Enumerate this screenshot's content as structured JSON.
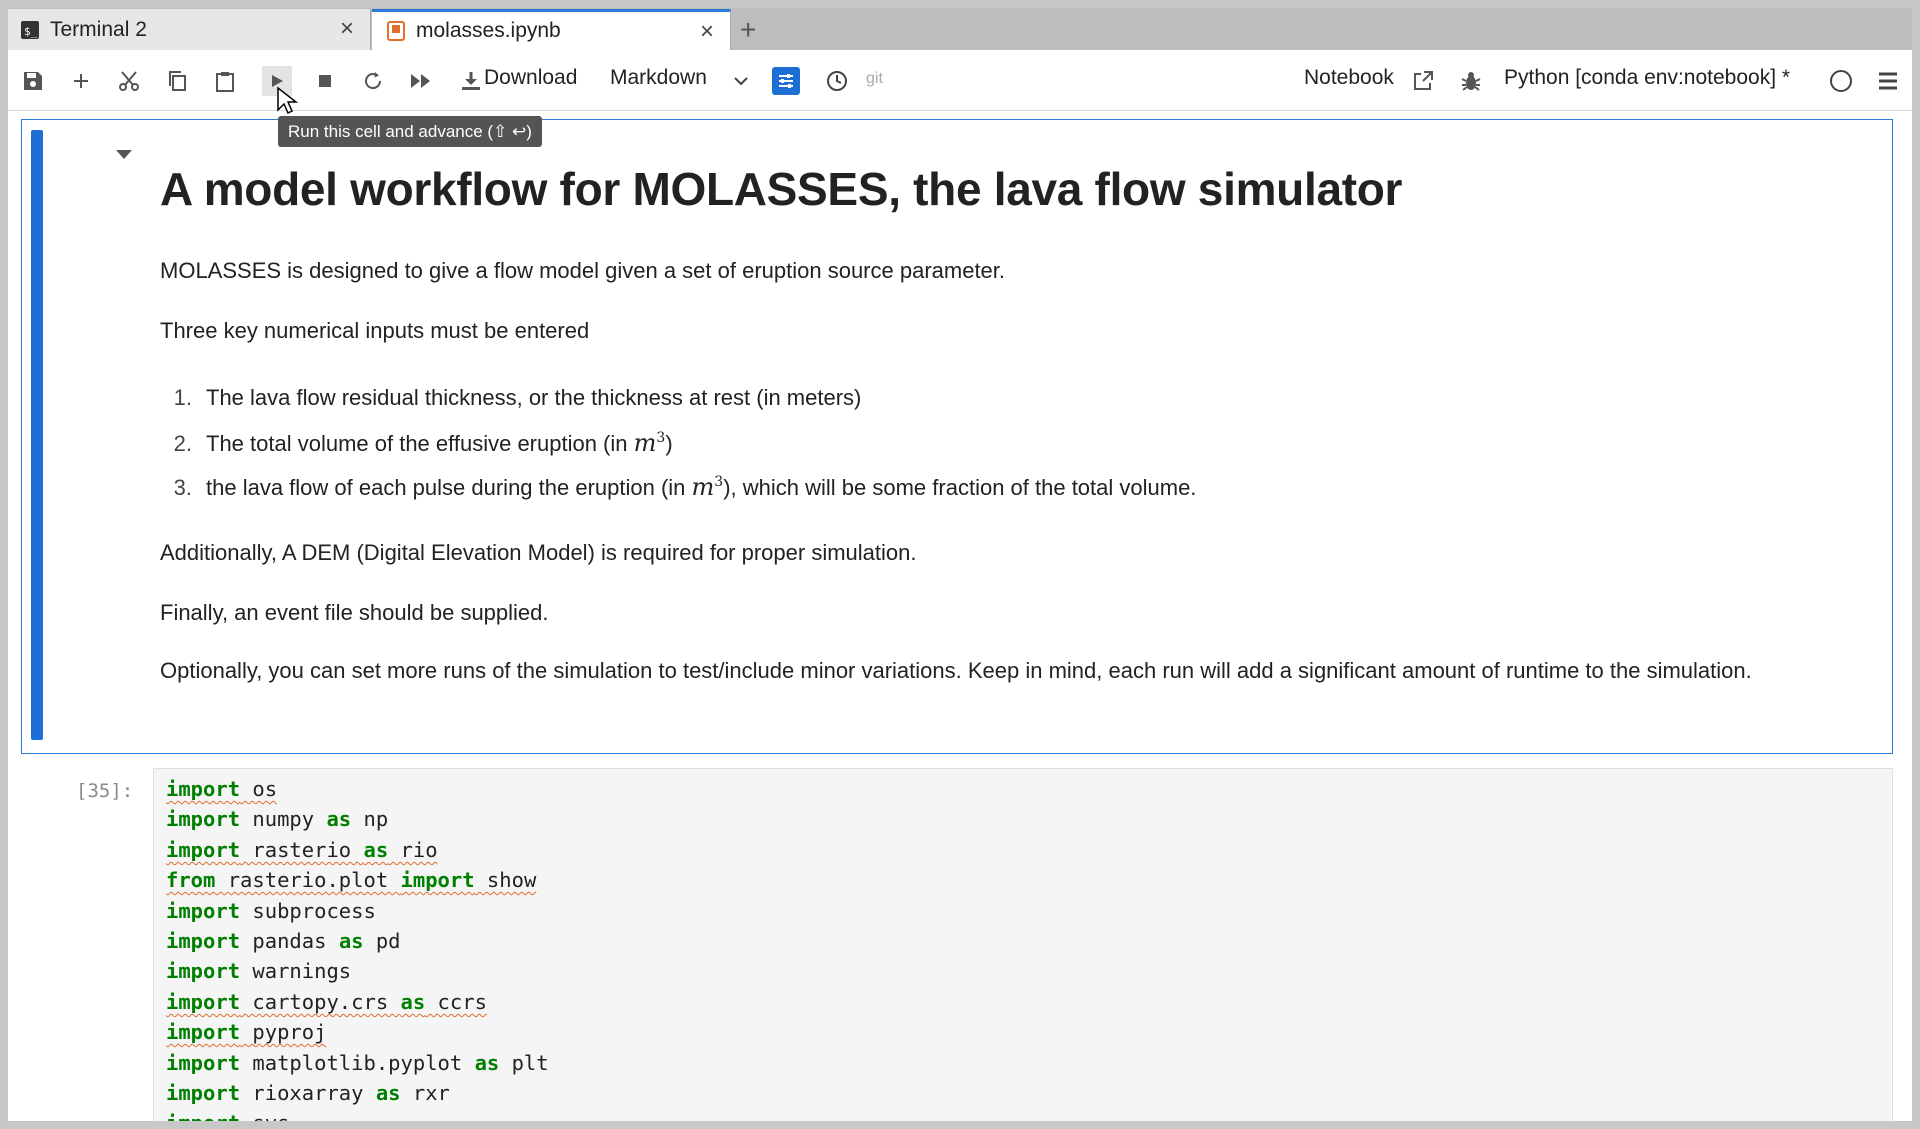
{
  "tabs": [
    {
      "label": "Terminal 2",
      "icon": "terminal-icon"
    },
    {
      "label": "molasses.ipynb",
      "icon": "notebook-icon",
      "active": true
    }
  ],
  "toolbar": {
    "download_label": "Download",
    "cell_type": "Markdown",
    "git_label": "git",
    "notebook_label": "Notebook",
    "kernel_label": "Python [conda env:notebook] *",
    "run_tooltip": "Run this cell and advance (⇧ ↩)"
  },
  "markdown": {
    "title": "A model workflow for MOLASSES, the lava flow simulator",
    "intro": "MOLASSES is designed to give a flow model given a set of eruption source parameter.",
    "key_inputs": "Three key numerical inputs must be entered",
    "list": [
      {
        "num": "1.",
        "text": "The lava flow residual thickness, or the thickness at rest (in meters)"
      },
      {
        "num": "2.",
        "pre": "The total volume of the effusive eruption (in ",
        "math": "m",
        "sup": "3",
        "post": ")"
      },
      {
        "num": "3.",
        "pre": "the lava flow of each pulse during the eruption (in ",
        "math": "m",
        "sup": "3",
        "post": "), which will be some fraction of the total volume."
      }
    ],
    "dem": "Additionally, A DEM (Digital Elevation Model) is required for proper simulation.",
    "event": "Finally, an event file should be supplied.",
    "optional": "Optionally, you can set more runs of the simulation to test/include minor variations. Keep in mind, each run will add a significant amount of runtime to the simulation."
  },
  "code_cell": {
    "prompt": "[35]:",
    "lines": [
      [
        {
          "t": "import",
          "k": 1,
          "s": 1
        },
        {
          "t": " os",
          "s": 1
        }
      ],
      [
        {
          "t": "import",
          "k": 1
        },
        {
          "t": " numpy "
        },
        {
          "t": "as",
          "k": 1
        },
        {
          "t": " np"
        }
      ],
      [
        {
          "t": "import",
          "k": 1,
          "s": 1
        },
        {
          "t": " rasterio ",
          "s": 1
        },
        {
          "t": "as",
          "k": 1,
          "s": 1
        },
        {
          "t": " rio",
          "s": 1
        }
      ],
      [
        {
          "t": "from",
          "k": 1,
          "s": 1
        },
        {
          "t": " rasterio.plot ",
          "s": 1
        },
        {
          "t": "import",
          "k": 1,
          "s": 1
        },
        {
          "t": " show",
          "s": 1
        }
      ],
      [
        {
          "t": "import",
          "k": 1
        },
        {
          "t": " subprocess"
        }
      ],
      [
        {
          "t": "import",
          "k": 1
        },
        {
          "t": " pandas "
        },
        {
          "t": "as",
          "k": 1
        },
        {
          "t": " pd"
        }
      ],
      [
        {
          "t": "import",
          "k": 1
        },
        {
          "t": " warnings"
        }
      ],
      [
        {
          "t": "import",
          "k": 1,
          "s": 1
        },
        {
          "t": " cartopy.crs ",
          "s": 1
        },
        {
          "t": "as",
          "k": 1,
          "s": 1
        },
        {
          "t": " ccrs",
          "s": 1
        }
      ],
      [
        {
          "t": "import",
          "k": 1,
          "s": 1
        },
        {
          "t": " pyproj",
          "s": 1
        }
      ],
      [
        {
          "t": "import",
          "k": 1
        },
        {
          "t": " matplotlib.pyplot "
        },
        {
          "t": "as",
          "k": 1
        },
        {
          "t": " plt"
        }
      ],
      [
        {
          "t": "import",
          "k": 1
        },
        {
          "t": " rioxarray "
        },
        {
          "t": "as",
          "k": 1
        },
        {
          "t": " rxr"
        }
      ],
      [
        {
          "t": "import",
          "k": 1,
          "s": 1
        },
        {
          "t": " sys",
          "s": 1
        }
      ]
    ]
  },
  "colors": {
    "accent": "#1e6fd4",
    "keyword": "#008000"
  }
}
